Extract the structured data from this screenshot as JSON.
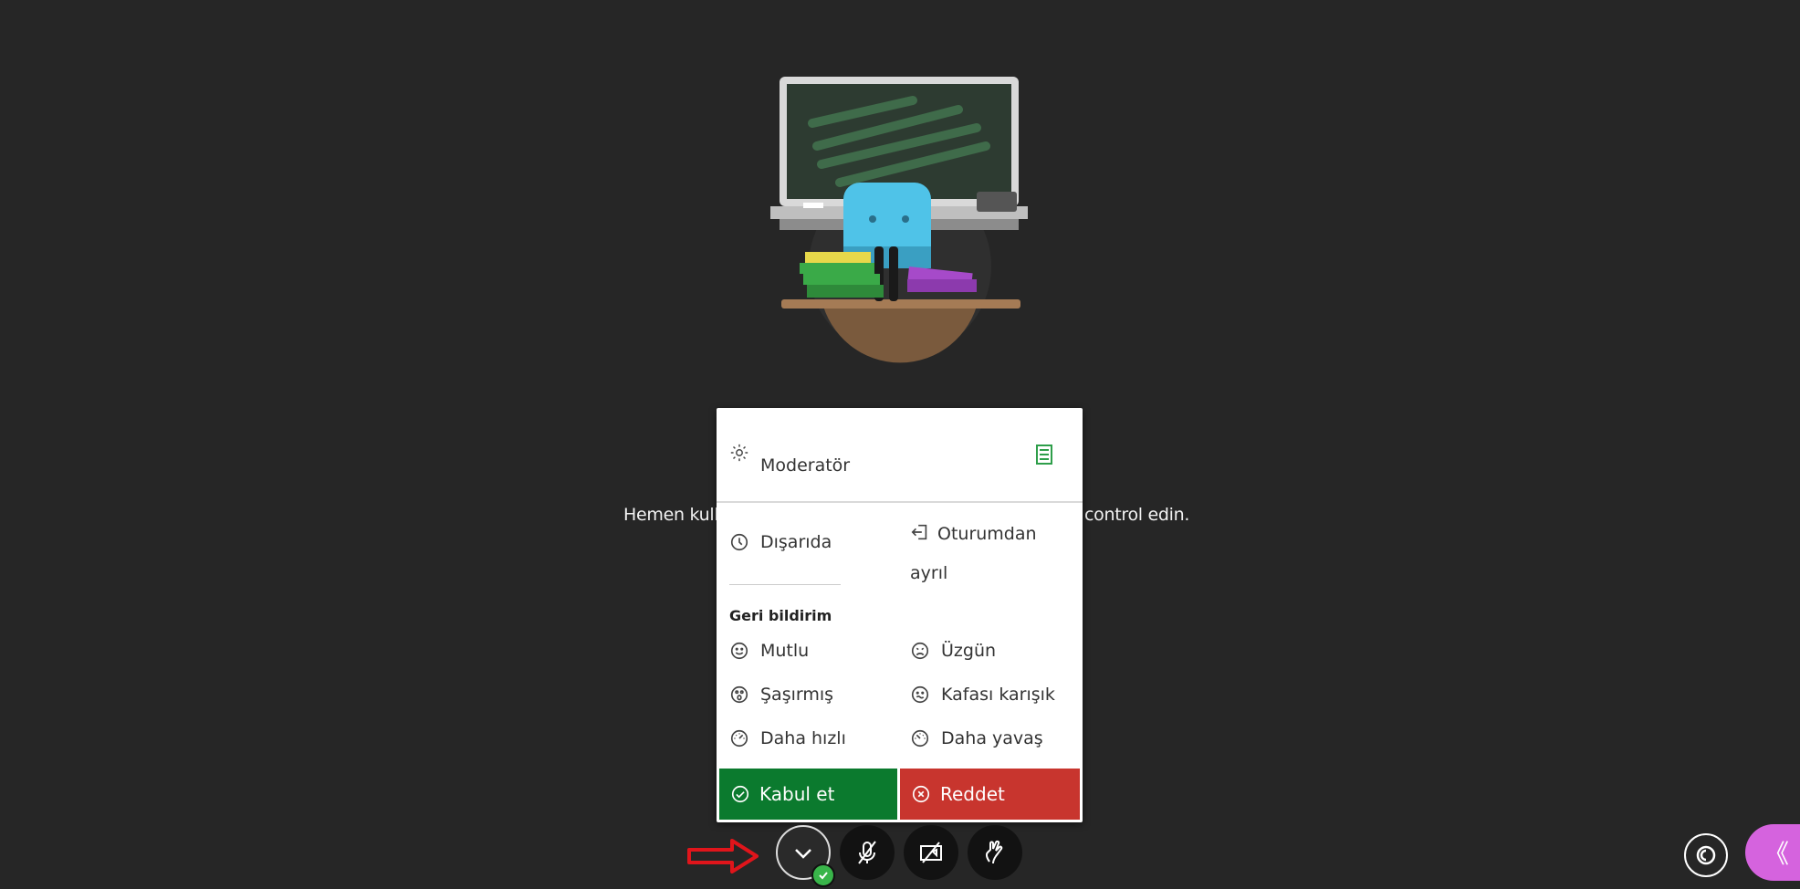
{
  "welcome": {
    "text_left": "Hemen kulla",
    "text_right": "control edin."
  },
  "menu": {
    "role": "Moderatör",
    "away_label": "Dışarıda",
    "leave_label_line1": "Oturumdan",
    "leave_label_line2": "ayrıl",
    "feedback_title": "Geri bildirim",
    "feedback": {
      "happy": "Mutlu",
      "sad": "Üzgün",
      "surprised": "Şaşırmış",
      "confused": "Kafası karışık",
      "faster": "Daha hızlı",
      "slower": "Daha yavaş"
    },
    "accept_label": "Kabul et",
    "reject_label": "Reddet"
  },
  "colors": {
    "background": "#262626",
    "accept": "#0b7a2e",
    "reject": "#c8352e",
    "panel_tab": "#d563de",
    "status_ok": "#39b54a",
    "arrow": "#e0151b"
  },
  "controls": {
    "panel_toggle_glyph": "《"
  },
  "icons": [
    "gear-icon",
    "list-icon",
    "clock-icon",
    "leave-icon",
    "happy-icon",
    "sad-icon",
    "surprised-icon",
    "confused-icon",
    "faster-icon",
    "slower-icon",
    "accept-icon",
    "reject-icon",
    "avatar-icon",
    "mic-muted-icon",
    "camera-off-icon",
    "raise-hand-icon",
    "captions-icon"
  ]
}
